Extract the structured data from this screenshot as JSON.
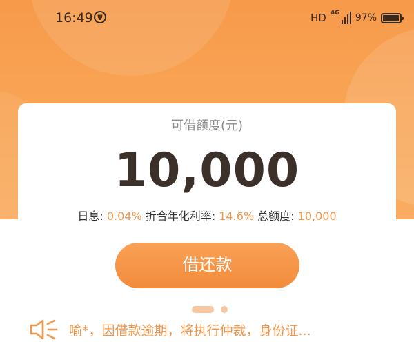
{
  "status_bar": {
    "time": "16:49",
    "extra_icon_glyph": "ψ",
    "hd": "HD",
    "network": "4G",
    "battery_percent": "97%",
    "battery_level": 0.97
  },
  "card": {
    "label": "可借额度(元)",
    "amount": "10,000",
    "rates": {
      "daily_label": "日息:",
      "daily_value": "0.04%",
      "annual_label": "折合年化利率:",
      "annual_value": "14.6%",
      "total_label": "总额度:",
      "total_value": "10,000"
    },
    "button_label": "借还款",
    "carousel": {
      "count": 2,
      "active_index": 0
    },
    "notice": "喻*，因借款逾期，将执行仲裁，身份证..."
  },
  "colors": {
    "accent": "#f0954a",
    "hero_top": "#f79a4a",
    "amount_text": "#3b302a",
    "dot": "#f5c8a3"
  },
  "icons": {
    "notice": "speaker-icon"
  }
}
